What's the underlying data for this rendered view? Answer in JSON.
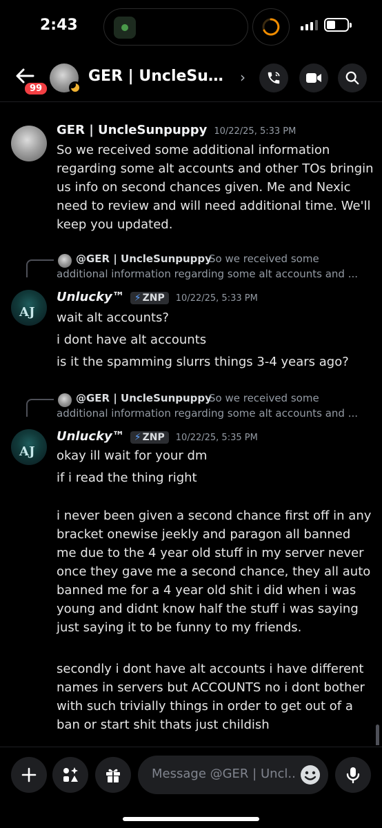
{
  "status": {
    "time": "2:43"
  },
  "header": {
    "unread_badge": "99",
    "title": "GER | UncleSunpu...",
    "chevron": "›"
  },
  "messages": [
    {
      "author": "GER | UncleSunpuppy",
      "timestamp": "10/22/25, 5:33 PM",
      "text": "So we received some additional information regarding some alt accounts and other TOs bringin us info on second chances given. Me and Nexic need to review and will need additional time. We'll keep you updated."
    },
    {
      "reply": {
        "author": "@GER | UncleSunpuppy",
        "snippet_1": "So we received some",
        "snippet_2": "additional information regarding some alt accounts and ..."
      },
      "author": "Unlucky™",
      "tag": "ZNP",
      "timestamp": "10/22/25, 5:33 PM",
      "lines": [
        "wait alt accounts?",
        "i dont have alt accounts",
        "is it the spamming slurrs things 3-4 years ago?"
      ]
    },
    {
      "reply": {
        "author": "@GER | UncleSunpuppy",
        "snippet_1": "So we received some",
        "snippet_2": "additional information regarding some alt accounts and ..."
      },
      "author": "Unlucky™",
      "tag": "ZNP",
      "timestamp": "10/22/25, 5:35 PM",
      "lines": [
        "okay ill wait for your dm",
        "if i read the thing right"
      ],
      "paragraph_1": "i never been given a second chance first off in any bracket onewise jeekly and paragon all banned me due to the 4 year old stuff in my server never once they gave me a second chance, they all auto banned me for a 4 year old shit i did when i was young and didnt know half the stuff i was saying just saying it to be funny to my friends.",
      "paragraph_2": "secondly i dont have alt accounts i have different names in servers but ACCOUNTS no i dont bother with such trivially things in order to get out of a ban or start shit thats just childish"
    }
  ],
  "composer": {
    "placeholder": "Message @GER | Uncl..."
  },
  "icons": {
    "back": "arrow-left-icon",
    "call": "phone-icon",
    "video": "video-camera-icon",
    "search": "search-icon",
    "add": "plus-icon",
    "apps": "apps-icon",
    "gift": "gift-icon",
    "emoji": "emoji-icon",
    "mic": "microphone-icon"
  },
  "colors": {
    "background": "#000000",
    "badge": "#f23f43",
    "status_idle": "#f0b232",
    "timer": "#f08c00"
  }
}
